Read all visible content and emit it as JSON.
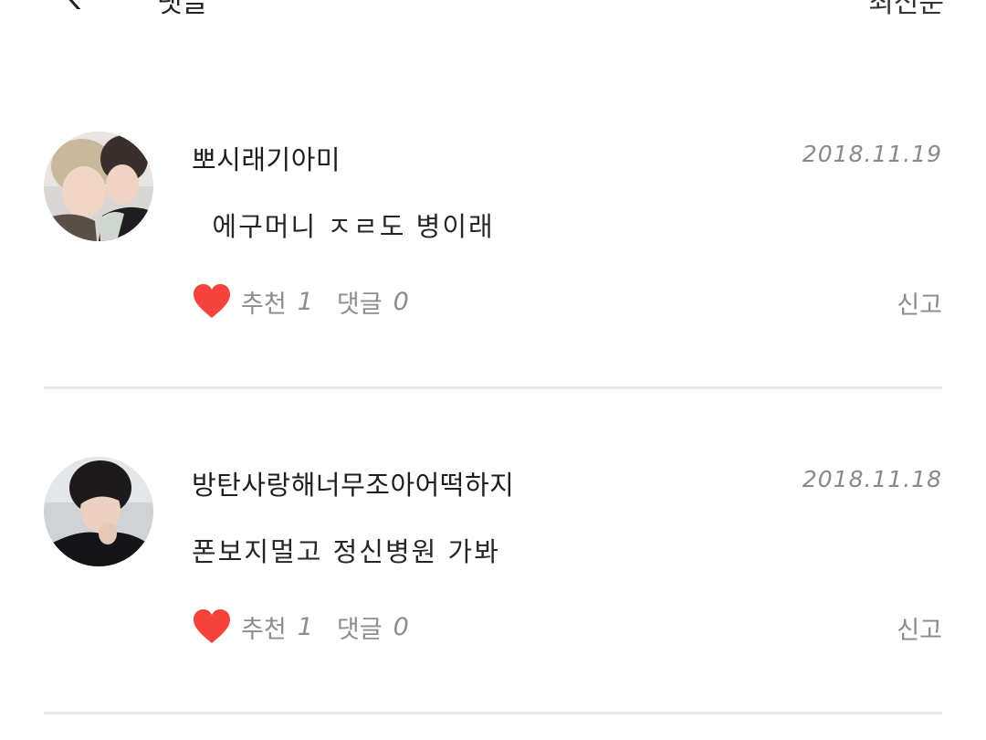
{
  "header": {
    "title": "댓글",
    "right_label": "최신순"
  },
  "comments": [
    {
      "username": "뽀시래기아미",
      "date": "2018.11.19",
      "text": "  에구머니 ㅈㄹ도 병이래",
      "like_label": "추천",
      "like_count": "1",
      "reply_label": "댓글",
      "reply_count": "0",
      "report_label": "신고"
    },
    {
      "username": "방탄사랑해너무조아어떡하지",
      "date": "2018.11.18",
      "text": "폰보지멀고 정신병원 가봐",
      "like_label": "추천",
      "like_count": "1",
      "reply_label": "댓글",
      "reply_count": "0",
      "report_label": "신고"
    }
  ],
  "colors": {
    "heart": "#f4433c",
    "divider": "#e6eaea",
    "meta_text": "#8d8d8d"
  },
  "icons": {
    "back": "chevron-left-icon",
    "like": "heart-icon"
  }
}
